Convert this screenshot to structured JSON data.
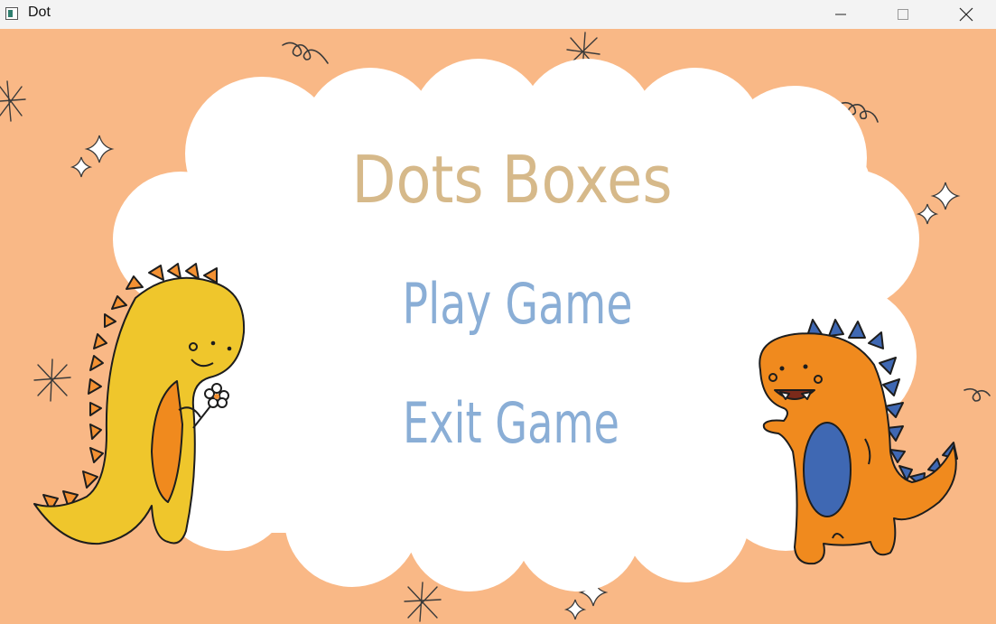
{
  "window": {
    "title": "Dot",
    "controls": [
      "minimize",
      "maximize",
      "close"
    ]
  },
  "game": {
    "title": "Dots Boxes",
    "menu": {
      "play_label": "Play Game",
      "exit_label": "Exit Game"
    }
  },
  "colors": {
    "background": "#f9b886",
    "cloud": "#ffffff",
    "title": "#d6b98a",
    "menu": "#8aaed6",
    "yellow_dino": "#efc62c",
    "orange_dino": "#f08a1e",
    "blue_spikes": "#3f68b3"
  },
  "icons": [
    "app-icon",
    "minimize-icon",
    "maximize-icon",
    "close-icon",
    "sparkle-icon",
    "swirl-icon",
    "starburst-icon"
  ]
}
